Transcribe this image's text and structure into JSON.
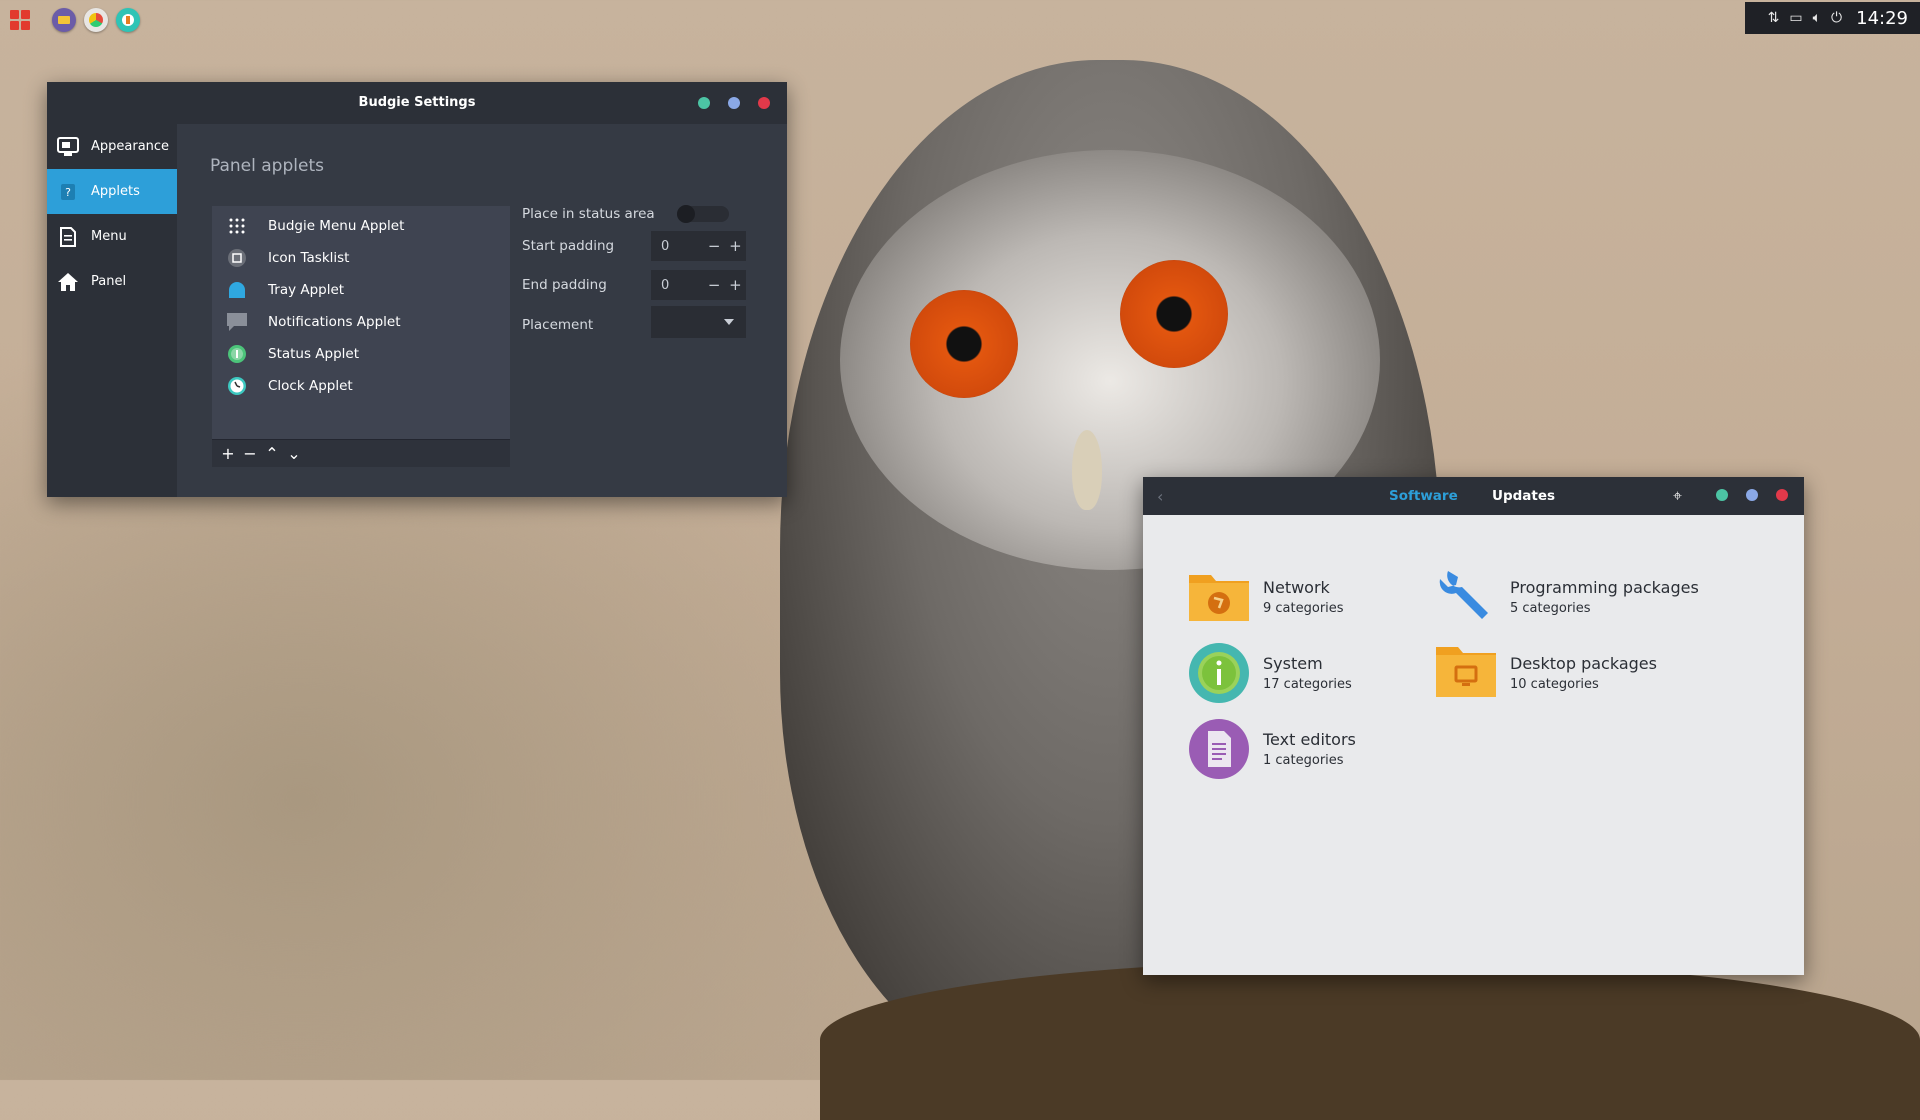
{
  "topbar": {
    "launchers": [
      {
        "icon": "files-icon",
        "color": "#6b5ca8"
      },
      {
        "icon": "browser-icon",
        "color": "#e8e6e3"
      },
      {
        "icon": "software-center-icon",
        "color": "#2ec4b6"
      }
    ],
    "tray": {
      "network_icon": "network-transfer-icon",
      "notification_icon": "notification-icon",
      "volume_icon": "volume-icon",
      "power_icon": "power-icon",
      "clock": "14:29"
    }
  },
  "budgie_settings": {
    "title": "Budgie Settings",
    "window_controls": {
      "minimize_color": "#4cc4a4",
      "maximize_color": "#8aa8e6",
      "close_color": "#e2394a"
    },
    "sidebar": [
      {
        "label": "Appearance",
        "icon": "appearance-icon",
        "active": false
      },
      {
        "label": "Applets",
        "icon": "applets-icon",
        "active": true
      },
      {
        "label": "Menu",
        "icon": "document-icon",
        "active": false
      },
      {
        "label": "Panel",
        "icon": "home-icon",
        "active": false
      }
    ],
    "heading": "Panel applets",
    "applets": [
      {
        "label": "Budgie Menu Applet",
        "icon": "grid-icon"
      },
      {
        "label": "Icon Tasklist",
        "icon": "tasklist-icon"
      },
      {
        "label": "Tray Applet",
        "icon": "tray-icon"
      },
      {
        "label": "Notifications Applet",
        "icon": "notification-icon"
      },
      {
        "label": "Status Applet",
        "icon": "status-icon"
      },
      {
        "label": "Clock Applet",
        "icon": "clock-icon"
      }
    ],
    "list_toolbar": {
      "add": "+",
      "remove": "−",
      "up": "⌃",
      "down": "⌄"
    },
    "properties": {
      "place_in_status_label": "Place in status area",
      "place_in_status_value": false,
      "start_padding_label": "Start padding",
      "start_padding_value": "0",
      "end_padding_label": "End padding",
      "end_padding_value": "0",
      "placement_label": "Placement",
      "minus": "−",
      "plus": "+"
    }
  },
  "software": {
    "tabs": [
      {
        "label": "Software",
        "active": true,
        "color": "#2d9fd9"
      },
      {
        "label": "Updates",
        "active": false,
        "color": "#ffffff"
      }
    ],
    "back_icon": "chevron-left-icon",
    "settings_icon": "settings-icon",
    "window_controls": {
      "minimize_color": "#4cc4a4",
      "maximize_color": "#8aa8e6",
      "close_color": "#e2394a"
    },
    "categories": [
      {
        "name": "Network",
        "sub": "9 categories",
        "icon": "network-folder-icon"
      },
      {
        "name": "Programming packages",
        "sub": "5 categories",
        "icon": "wrench-icon"
      },
      {
        "name": "System",
        "sub": "17 categories",
        "icon": "system-info-icon"
      },
      {
        "name": "Desktop packages",
        "sub": "10 categories",
        "icon": "desktop-folder-icon"
      },
      {
        "name": "Text editors",
        "sub": "1 categories",
        "icon": "text-editor-icon"
      }
    ]
  }
}
